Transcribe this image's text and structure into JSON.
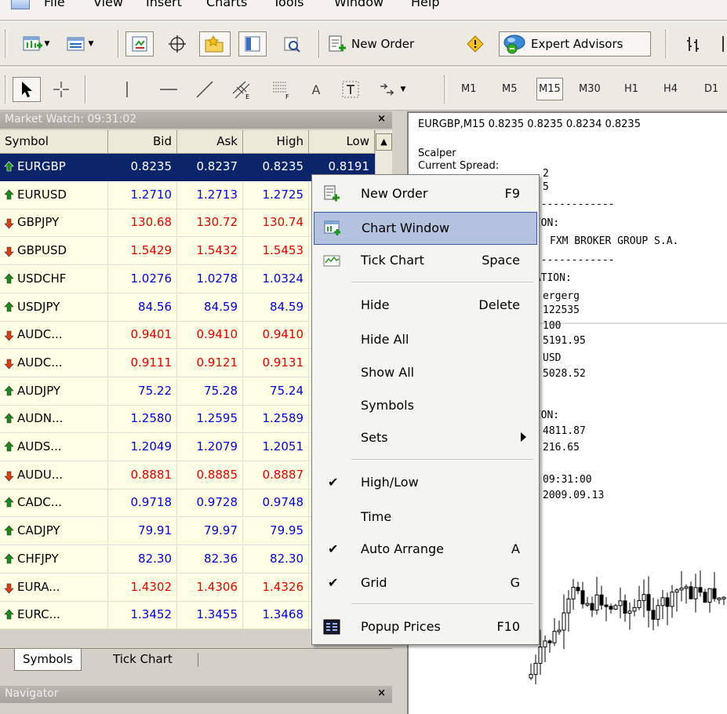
{
  "menubar": {
    "items": [
      "File",
      "View",
      "Insert",
      "Charts",
      "Tools",
      "Window",
      "Help"
    ]
  },
  "toolbar1": {
    "new_order_label": "New Order",
    "expert_advisors_label": "Expert Advisors"
  },
  "toolbar2": {
    "text_tool": "A",
    "timeframes": [
      "M1",
      "M5",
      "M15",
      "M30",
      "H1",
      "H4",
      "D1"
    ],
    "active_timeframe": "M15"
  },
  "market_watch": {
    "title": "Market Watch: 09:31:02",
    "columns": [
      "Symbol",
      "Bid",
      "Ask",
      "High",
      "Low"
    ],
    "rows": [
      {
        "symbol": "EURGBP",
        "bid": "0.8235",
        "ask": "0.8237",
        "high": "0.8235",
        "low": "0.8191",
        "dir": "up",
        "selected": true
      },
      {
        "symbol": "EURUSD",
        "bid": "1.2710",
        "ask": "1.2713",
        "high": "1.2725",
        "low": "",
        "dir": "up"
      },
      {
        "symbol": "GBPJPY",
        "bid": "130.68",
        "ask": "130.72",
        "high": "130.74",
        "low": "",
        "dir": "down"
      },
      {
        "symbol": "GBPUSD",
        "bid": "1.5429",
        "ask": "1.5432",
        "high": "1.5453",
        "low": "",
        "dir": "down"
      },
      {
        "symbol": "USDCHF",
        "bid": "1.0276",
        "ask": "1.0278",
        "high": "1.0324",
        "low": "",
        "dir": "up"
      },
      {
        "symbol": "USDJPY",
        "bid": "84.56",
        "ask": "84.59",
        "high": "84.59",
        "low": "",
        "dir": "up"
      },
      {
        "symbol": "AUDC...",
        "bid": "0.9401",
        "ask": "0.9410",
        "high": "0.9410",
        "low": "",
        "dir": "down"
      },
      {
        "symbol": "AUDC...",
        "bid": "0.9111",
        "ask": "0.9121",
        "high": "0.9131",
        "low": "",
        "dir": "down"
      },
      {
        "symbol": "AUDJPY",
        "bid": "75.22",
        "ask": "75.28",
        "high": "75.24",
        "low": "",
        "dir": "up"
      },
      {
        "symbol": "AUDN...",
        "bid": "1.2580",
        "ask": "1.2595",
        "high": "1.2589",
        "low": "",
        "dir": "up"
      },
      {
        "symbol": "AUDS...",
        "bid": "1.2049",
        "ask": "1.2079",
        "high": "1.2051",
        "low": "",
        "dir": "up"
      },
      {
        "symbol": "AUDU...",
        "bid": "0.8881",
        "ask": "0.8885",
        "high": "0.8887",
        "low": "",
        "dir": "down"
      },
      {
        "symbol": "CADC...",
        "bid": "0.9718",
        "ask": "0.9728",
        "high": "0.9748",
        "low": "",
        "dir": "up"
      },
      {
        "symbol": "CADJPY",
        "bid": "79.91",
        "ask": "79.97",
        "high": "79.95",
        "low": "",
        "dir": "up"
      },
      {
        "symbol": "CHFJPY",
        "bid": "82.30",
        "ask": "82.36",
        "high": "82.30",
        "low": "",
        "dir": "up"
      },
      {
        "symbol": "EURA...",
        "bid": "1.4302",
        "ask": "1.4306",
        "high": "1.4326",
        "low": "",
        "dir": "down"
      },
      {
        "symbol": "EURC...",
        "bid": "1.3452",
        "ask": "1.3455",
        "high": "1.3468",
        "low": "",
        "dir": "up"
      }
    ],
    "tabs": [
      "Symbols",
      "Tick Chart"
    ],
    "active_tab": "Symbols"
  },
  "navigator": {
    "title": "Navigator"
  },
  "chart": {
    "header": "EURGBP,M15  0.8235 0.8235 0.8234 0.8235",
    "info_lines": [
      "Scalper",
      "Current Spread:",
      "2",
      "5",
      "--------------",
      "TION:",
      "FXM BROKER GROUP S.A.",
      "--------------",
      "MATION:",
      "ergerg",
      "122535",
      "100",
      "5191.95",
      "USD",
      "5028.52",
      "TION:",
      "4811.87",
      "216.65",
      "09:31:00",
      "2009.09.13"
    ]
  },
  "context_menu": {
    "items": [
      {
        "label": "New Order",
        "shortcut": "F9",
        "icon": "new-order-icon"
      },
      {
        "label": "Chart Window",
        "shortcut": "",
        "icon": "chart-window-icon",
        "highlighted": true
      },
      {
        "label": "Tick Chart",
        "shortcut": "Space",
        "icon": "tick-chart-icon"
      },
      {
        "label": "Hide",
        "shortcut": "Delete"
      },
      {
        "label": "Hide All",
        "shortcut": ""
      },
      {
        "label": "Show All",
        "shortcut": ""
      },
      {
        "label": "Symbols",
        "shortcut": ""
      },
      {
        "label": "Sets",
        "shortcut": "",
        "submenu": true
      },
      {
        "label": "High/Low",
        "shortcut": "",
        "checked": true
      },
      {
        "label": "Time",
        "shortcut": ""
      },
      {
        "label": "Auto Arrange",
        "shortcut": "A",
        "checked": true
      },
      {
        "label": "Grid",
        "shortcut": "G",
        "checked": true
      },
      {
        "label": "Popup Prices",
        "shortcut": "F10",
        "icon": "popup-prices-icon"
      }
    ]
  },
  "colors": {
    "up": "#0000e8",
    "down": "#e40000",
    "up_arrow": "#1a8a1a",
    "down_arrow": "#e03a10",
    "selection": "#0c246a",
    "row_bg": "#ffffe4",
    "menu_highlight": "#b4c2de"
  }
}
